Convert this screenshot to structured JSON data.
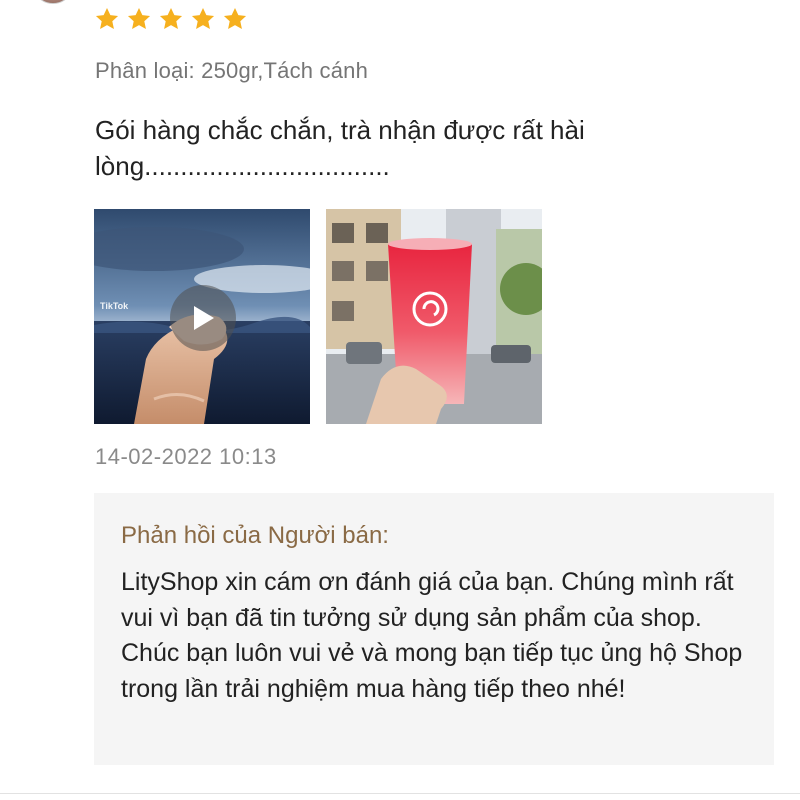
{
  "review": {
    "rating": 5,
    "rating_max": 5,
    "star_color": "#f6b01e",
    "variation": "Phân loại: 250gr,Tách cánh",
    "text": "Gói hàng chắc chắn, trà nhận được rất hài lòng..................................",
    "media": [
      {
        "type": "video",
        "icon": "play-icon",
        "watermark": "TikTok"
      },
      {
        "type": "photo"
      }
    ],
    "timestamp": "14-02-2022 10:13"
  },
  "seller_reply": {
    "title": "Phản hồi của Người bán:",
    "text": "LityShop xin cám ơn đánh giá của bạn. Chúng mình rất vui vì bạn đã tin tưởng sử dụng sản phẩm của shop. Chúc bạn luôn vui vẻ và mong bạn tiếp tục ủng hộ Shop trong lần trải nghiệm mua hàng tiếp theo nhé!",
    "title_color": "#8a6a45",
    "background": "#f5f5f5"
  }
}
